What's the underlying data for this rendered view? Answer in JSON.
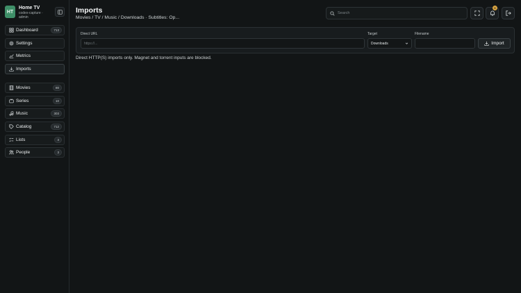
{
  "brand": {
    "initials": "HT",
    "title": "Home TV",
    "subtitle": "codex-capture · admin"
  },
  "sidebar": {
    "primary": [
      {
        "label": "Dashboard",
        "badge": "713",
        "icon": "grid-icon"
      },
      {
        "label": "Settings",
        "badge": "",
        "icon": "gear-icon"
      },
      {
        "label": "Metrics",
        "badge": "",
        "icon": "chart-icon"
      },
      {
        "label": "Imports",
        "badge": "",
        "icon": "download-icon",
        "active": true
      }
    ],
    "library": [
      {
        "label": "Movies",
        "badge": "80",
        "icon": "film-icon"
      },
      {
        "label": "Series",
        "badge": "10",
        "icon": "tv-icon"
      },
      {
        "label": "Music",
        "badge": "303",
        "icon": "music-icon"
      },
      {
        "label": "Catalog",
        "badge": "712",
        "icon": "tag-icon"
      },
      {
        "label": "Lists",
        "badge": "3",
        "icon": "list-icon"
      },
      {
        "label": "People",
        "badge": "3",
        "icon": "people-icon"
      }
    ]
  },
  "header": {
    "title": "Imports",
    "breadcrumb": "Movies / TV / Music / Downloads · Subtitles: Op...",
    "search_placeholder": "Search",
    "notification_count": "0"
  },
  "form": {
    "url_label": "Direct URL",
    "url_placeholder": "https://...",
    "url_value": "",
    "target_label": "Target",
    "target_value": "Downloads",
    "filename_label": "Filename",
    "filename_value": "",
    "import_label": "Import"
  },
  "note": "Direct HTTP(S) imports only. Magnet and torrent inputs are blocked.",
  "colors": {
    "background": "#121516",
    "avatar": "#3f8f68",
    "badge": "#d9a441"
  }
}
